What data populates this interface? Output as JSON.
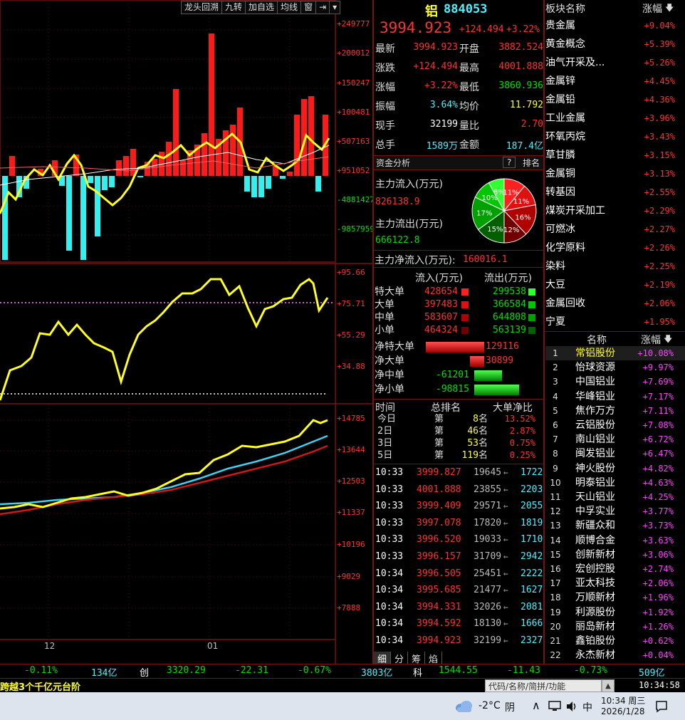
{
  "toolbar": {
    "items": [
      "龙头回溯",
      "九转",
      "加自选",
      "均线",
      "窗",
      "⇥",
      "▾"
    ]
  },
  "volume_axis": [
    "+249777",
    "+200012",
    "+150247",
    "+100481",
    "+507163",
    "+951052",
    "-4881427",
    "-9857959"
  ],
  "mid_axis": [
    "+95.66",
    "+75.71",
    "+55.29",
    "+34.88"
  ],
  "price_axis": [
    "+14785",
    "+13644",
    "+12503",
    "+11337",
    "+10196",
    "+9029",
    "+7888"
  ],
  "date_labels": [
    "12",
    "01"
  ],
  "quote": {
    "name": "铝",
    "code": "884053",
    "price": "3994.923",
    "change": "+124.494",
    "pct": "+3.22%",
    "rows": [
      {
        "l1": "最新",
        "v1": "3994.923",
        "c1": "red",
        "l2": "开盘",
        "v2": "3882.524",
        "c2": "red"
      },
      {
        "l1": "涨跌",
        "v1": "+124.494",
        "c1": "red",
        "l2": "最高",
        "v2": "4001.888",
        "c2": "red"
      },
      {
        "l1": "涨幅",
        "v1": "+3.22%",
        "c1": "red",
        "l2": "最低",
        "v2": "3860.936",
        "c2": "grn"
      },
      {
        "l1": "振幅",
        "v1": "3.64%",
        "c1": "cyan",
        "l2": "均价",
        "v2": "11.792",
        "c2": "yel"
      },
      {
        "l1": "现手",
        "v1": "32199",
        "c1": "wht",
        "l2": "量比",
        "v2": "2.70",
        "c2": "red"
      },
      {
        "l1": "总手",
        "v1": "1589万",
        "c1": "cyan",
        "l2": "金额",
        "v2": "187.4亿",
        "c2": "cyan"
      }
    ]
  },
  "fund": {
    "title": "资金分析",
    "help": "?",
    "rank": "排名",
    "inflow_label": "主力流入(万元)",
    "inflow_value": "826138.9",
    "outflow_label": "主力流出(万元)",
    "outflow_value": "666122.8",
    "net_label": "主力净流入(万元):",
    "net_value": "160016.1",
    "pie": [
      {
        "label": "11%",
        "value": 11,
        "color": "#ff2020"
      },
      {
        "label": "11%",
        "value": 11,
        "color": "#e01010"
      },
      {
        "label": "16%",
        "value": 16,
        "color": "#b00000"
      },
      {
        "label": "12%",
        "value": 12,
        "color": "#700000"
      },
      {
        "label": "15%",
        "value": 15,
        "color": "#006000"
      },
      {
        "label": "17%",
        "value": 17,
        "color": "#00a000"
      },
      {
        "label": "10%",
        "value": 10,
        "color": "#00c800"
      },
      {
        "label": "8%",
        "value": 8,
        "color": "#30ff30"
      }
    ],
    "flow_head_in": "流入(万元)",
    "flow_head_out": "流出(万元)",
    "flows": [
      {
        "label": "特大单",
        "in": "428654",
        "out": "299538"
      },
      {
        "label": "大单",
        "in": "397483",
        "out": "366584"
      },
      {
        "label": "中单",
        "in": "583607",
        "out": "644808"
      },
      {
        "label": "小单",
        "in": "464324",
        "out": "563139"
      }
    ],
    "nets": [
      {
        "label": "净特大单",
        "value": "129116",
        "amount": 129116
      },
      {
        "label": "净大单",
        "value": "30899",
        "amount": 30899
      },
      {
        "label": "净中单",
        "value": "-61201",
        "amount": -61201
      },
      {
        "label": "净小单",
        "value": "-98815",
        "amount": -98815
      }
    ]
  },
  "rank": {
    "head": [
      "时间",
      "总排名",
      "大单净比"
    ],
    "rows": [
      {
        "t": "今日",
        "p": "第",
        "n": "8",
        "u": "名",
        "r": "13.52%"
      },
      {
        "t": "2日",
        "p": "第",
        "n": "46",
        "u": "名",
        "r": "2.87%"
      },
      {
        "t": "3日",
        "p": "第",
        "n": "53",
        "u": "名",
        "r": "0.75%"
      },
      {
        "t": "5日",
        "p": "第",
        "n": "119",
        "u": "名",
        "r": "0.25%"
      }
    ]
  },
  "ticks": [
    {
      "t": "10:33",
      "p": "3999.827",
      "v": "19645",
      "n": "1722"
    },
    {
      "t": "10:33",
      "p": "4001.888",
      "v": "23855",
      "n": "2203"
    },
    {
      "t": "10:33",
      "p": "3999.409",
      "v": "29571",
      "n": "2055"
    },
    {
      "t": "10:33",
      "p": "3997.078",
      "v": "17820",
      "n": "1819"
    },
    {
      "t": "10:33",
      "p": "3996.520",
      "v": "19033",
      "n": "1710"
    },
    {
      "t": "10:33",
      "p": "3996.157",
      "v": "31709",
      "n": "2942"
    },
    {
      "t": "10:34",
      "p": "3996.505",
      "v": "25451",
      "n": "2222"
    },
    {
      "t": "10:34",
      "p": "3995.685",
      "v": "21477",
      "n": "1627"
    },
    {
      "t": "10:34",
      "p": "3994.331",
      "v": "32026",
      "n": "2081"
    },
    {
      "t": "10:34",
      "p": "3994.592",
      "v": "18130",
      "n": "1666"
    },
    {
      "t": "10:34",
      "p": "3994.923",
      "v": "32199",
      "n": "2327"
    }
  ],
  "bottom_tabs": [
    "细",
    "分",
    "筹",
    "焰"
  ],
  "sectors": {
    "head_name": "板块名称",
    "head_pct": "涨幅",
    "items": [
      {
        "n": "贵金属",
        "p": "+9.04%"
      },
      {
        "n": "黄金概念",
        "p": "+5.39%"
      },
      {
        "n": "油气开采及...",
        "p": "+5.26%"
      },
      {
        "n": "金属锌",
        "p": "+4.45%"
      },
      {
        "n": "金属铅",
        "p": "+4.36%"
      },
      {
        "n": "工业金属",
        "p": "+3.96%"
      },
      {
        "n": "环氧丙烷",
        "p": "+3.43%"
      },
      {
        "n": "草甘膦",
        "p": "+3.15%"
      },
      {
        "n": "金属铜",
        "p": "+3.13%"
      },
      {
        "n": "转基因",
        "p": "+2.55%"
      },
      {
        "n": "煤炭开采加工",
        "p": "+2.29%"
      },
      {
        "n": "可燃冰",
        "p": "+2.27%"
      },
      {
        "n": "化学原料",
        "p": "+2.26%"
      },
      {
        "n": "染料",
        "p": "+2.25%"
      },
      {
        "n": "大豆",
        "p": "+2.19%"
      },
      {
        "n": "金属回收",
        "p": "+2.06%"
      },
      {
        "n": "宁夏",
        "p": "+1.95%"
      }
    ]
  },
  "stocks": {
    "head_name": "名称",
    "head_pct": "涨幅",
    "items": [
      {
        "i": "1",
        "n": "常铝股份",
        "p": "+10.08%"
      },
      {
        "i": "2",
        "n": "怡球资源",
        "p": "+9.97%"
      },
      {
        "i": "3",
        "n": "中国铝业",
        "p": "+7.69%"
      },
      {
        "i": "4",
        "n": "华峰铝业",
        "p": "+7.17%"
      },
      {
        "i": "5",
        "n": "焦作万方",
        "p": "+7.11%"
      },
      {
        "i": "6",
        "n": "云铝股份",
        "p": "+7.08%"
      },
      {
        "i": "7",
        "n": "南山铝业",
        "p": "+6.72%"
      },
      {
        "i": "8",
        "n": "闽发铝业",
        "p": "+6.47%"
      },
      {
        "i": "9",
        "n": "神火股份",
        "p": "+4.82%"
      },
      {
        "i": "10",
        "n": "明泰铝业",
        "p": "+4.63%"
      },
      {
        "i": "11",
        "n": "天山铝业",
        "p": "+4.25%"
      },
      {
        "i": "12",
        "n": "中孚实业",
        "p": "+3.77%"
      },
      {
        "i": "13",
        "n": "新疆众和",
        "p": "+3.73%"
      },
      {
        "i": "14",
        "n": "顺博合金",
        "p": "+3.63%"
      },
      {
        "i": "15",
        "n": "创新新材",
        "p": "+3.06%"
      },
      {
        "i": "16",
        "n": "宏创控股",
        "p": "+2.74%"
      },
      {
        "i": "17",
        "n": "亚太科技",
        "p": "+2.06%"
      },
      {
        "i": "18",
        "n": "万顺新材",
        "p": "+1.96%"
      },
      {
        "i": "19",
        "n": "利源股份",
        "p": "+1.92%"
      },
      {
        "i": "20",
        "n": "丽岛新材",
        "p": "+1.26%"
      },
      {
        "i": "21",
        "n": "鑫铂股份",
        "p": "+0.62%"
      },
      {
        "i": "22",
        "n": "永杰新材",
        "p": "+0.04%"
      }
    ]
  },
  "status_bar": {
    "a1": "-0.11%",
    "a2": "134亿",
    "b0": "创",
    "b1": "3320.29",
    "b2": "-22.31",
    "b3": "-0.67%",
    "b4": "3803亿",
    "c0": "科",
    "c1": "1544.55",
    "c2": "-11.43",
    "c3": "-0.73%",
    "c4": "509亿"
  },
  "news": "跨越3个千亿元台阶",
  "search_placeholder": "代码/名称/简拼/功能",
  "clock_small": "10:34:58",
  "taskbar": {
    "temp": "-2°C",
    "weather": "阴",
    "ime": "中",
    "time": "10:34 周三",
    "date": "2026/1/28"
  }
}
